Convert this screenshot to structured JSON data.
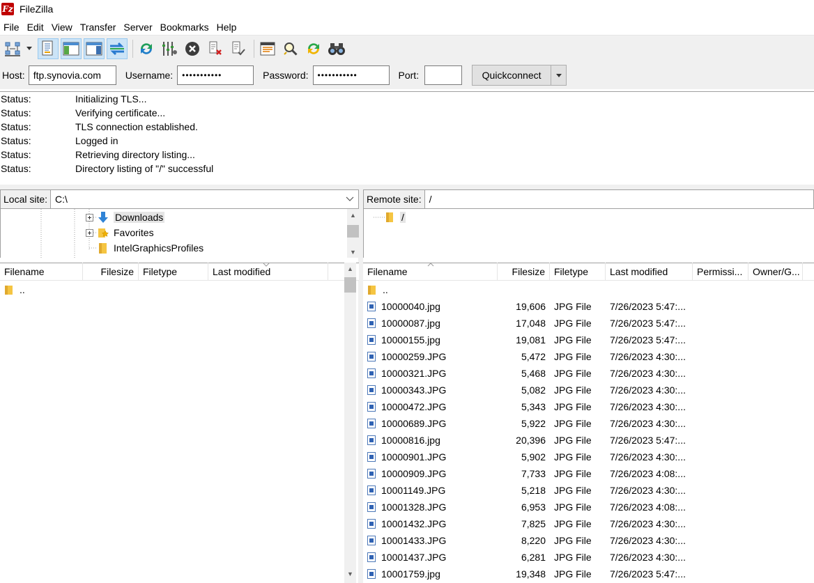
{
  "window": {
    "title": "FileZilla"
  },
  "menu": [
    "File",
    "Edit",
    "View",
    "Transfer",
    "Server",
    "Bookmarks",
    "Help"
  ],
  "toolbar": {
    "buttons": [
      "site-manager-icon",
      "toggle-message-log-icon",
      "toggle-local-tree-icon",
      "toggle-remote-tree-icon",
      "toggle-transfer-queue-icon",
      "refresh-icon",
      "filter-icon",
      "cancel-icon",
      "disconnect-icon",
      "reconnect-icon",
      "directory-listing-icon",
      "search-icon",
      "sync-browse-icon",
      "find-files-icon"
    ]
  },
  "quickconnect": {
    "host_label": "Host:",
    "host_value": "ftp.synovia.com",
    "username_label": "Username:",
    "username_value": "•••••••••••",
    "password_label": "Password:",
    "password_value": "•••••••••••",
    "port_label": "Port:",
    "port_value": "",
    "button_label": "Quickconnect"
  },
  "log": [
    {
      "key": "Status:",
      "value": "Initializing TLS..."
    },
    {
      "key": "Status:",
      "value": "Verifying certificate..."
    },
    {
      "key": "Status:",
      "value": "TLS connection established."
    },
    {
      "key": "Status:",
      "value": "Logged in"
    },
    {
      "key": "Status:",
      "value": "Retrieving directory listing..."
    },
    {
      "key": "Status:",
      "value": "Directory listing of \"/\" successful"
    }
  ],
  "local": {
    "site_label": "Local site:",
    "path": "C:\\",
    "tree": [
      {
        "label": "Downloads"
      },
      {
        "label": "Favorites"
      },
      {
        "label": "IntelGraphicsProfiles"
      }
    ],
    "columns": [
      "Filename",
      "Filesize",
      "Filetype",
      "Last modified"
    ],
    "files": [
      {
        "name": ".."
      }
    ]
  },
  "remote": {
    "site_label": "Remote site:",
    "path": "/",
    "tree": [
      {
        "label": "/"
      }
    ],
    "columns": [
      "Filename",
      "Filesize",
      "Filetype",
      "Last modified",
      "Permissi...",
      "Owner/G..."
    ],
    "parent": "..",
    "files": [
      {
        "name": "10000040.jpg",
        "size": "19,606",
        "type": "JPG File",
        "modified": "7/26/2023 5:47:..."
      },
      {
        "name": "10000087.jpg",
        "size": "17,048",
        "type": "JPG File",
        "modified": "7/26/2023 5:47:..."
      },
      {
        "name": "10000155.jpg",
        "size": "19,081",
        "type": "JPG File",
        "modified": "7/26/2023 5:47:..."
      },
      {
        "name": "10000259.JPG",
        "size": "5,472",
        "type": "JPG File",
        "modified": "7/26/2023 4:30:..."
      },
      {
        "name": "10000321.JPG",
        "size": "5,468",
        "type": "JPG File",
        "modified": "7/26/2023 4:30:..."
      },
      {
        "name": "10000343.JPG",
        "size": "5,082",
        "type": "JPG File",
        "modified": "7/26/2023 4:30:..."
      },
      {
        "name": "10000472.JPG",
        "size": "5,343",
        "type": "JPG File",
        "modified": "7/26/2023 4:30:..."
      },
      {
        "name": "10000689.JPG",
        "size": "5,922",
        "type": "JPG File",
        "modified": "7/26/2023 4:30:..."
      },
      {
        "name": "10000816.jpg",
        "size": "20,396",
        "type": "JPG File",
        "modified": "7/26/2023 5:47:..."
      },
      {
        "name": "10000901.JPG",
        "size": "5,902",
        "type": "JPG File",
        "modified": "7/26/2023 4:30:..."
      },
      {
        "name": "10000909.JPG",
        "size": "7,733",
        "type": "JPG File",
        "modified": "7/26/2023 4:08:..."
      },
      {
        "name": "10001149.JPG",
        "size": "5,218",
        "type": "JPG File",
        "modified": "7/26/2023 4:30:..."
      },
      {
        "name": "10001328.JPG",
        "size": "6,953",
        "type": "JPG File",
        "modified": "7/26/2023 4:08:..."
      },
      {
        "name": "10001432.JPG",
        "size": "7,825",
        "type": "JPG File",
        "modified": "7/26/2023 4:30:..."
      },
      {
        "name": "10001433.JPG",
        "size": "8,220",
        "type": "JPG File",
        "modified": "7/26/2023 4:30:..."
      },
      {
        "name": "10001437.JPG",
        "size": "6,281",
        "type": "JPG File",
        "modified": "7/26/2023 4:30:..."
      },
      {
        "name": "10001759.jpg",
        "size": "19,348",
        "type": "JPG File",
        "modified": "7/26/2023 5:47:..."
      }
    ]
  }
}
